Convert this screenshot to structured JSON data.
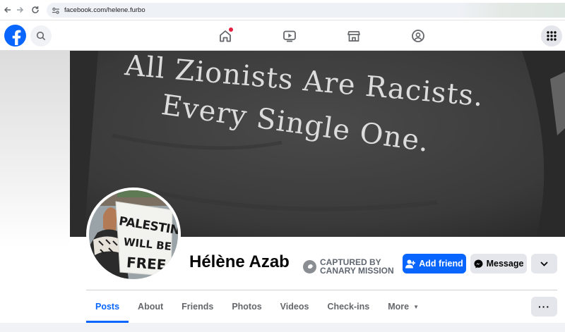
{
  "browser": {
    "url": "facebook.com/helene.furbo",
    "icons": [
      "back-arrow-icon",
      "forward-arrow-icon",
      "reload-icon",
      "site-settings-icon"
    ]
  },
  "header": {
    "icons": [
      "facebook-logo-icon",
      "search-icon",
      "home-icon",
      "video-icon",
      "marketplace-icon",
      "groups-icon",
      "menu-grid-icon"
    ],
    "home_has_notification": true,
    "brand_color": "#0866ff"
  },
  "cover": {
    "line1": "All Zionists Are Racists.",
    "line2": "Every Single One."
  },
  "avatar": {
    "sign_lines": [
      "PALESTINE",
      "WILL BE",
      "FREE"
    ]
  },
  "profile": {
    "name": "Hélène Azab",
    "badge_line1": "CAPTURED BY",
    "badge_line2": "CANARY MISSION",
    "add_friend_label": "Add friend",
    "message_label": "Message"
  },
  "tabs": [
    {
      "label": "Posts",
      "active": true
    },
    {
      "label": "About"
    },
    {
      "label": "Friends"
    },
    {
      "label": "Photos"
    },
    {
      "label": "Videos"
    },
    {
      "label": "Check-ins"
    },
    {
      "label": "More"
    }
  ],
  "more_actions_label": "···"
}
